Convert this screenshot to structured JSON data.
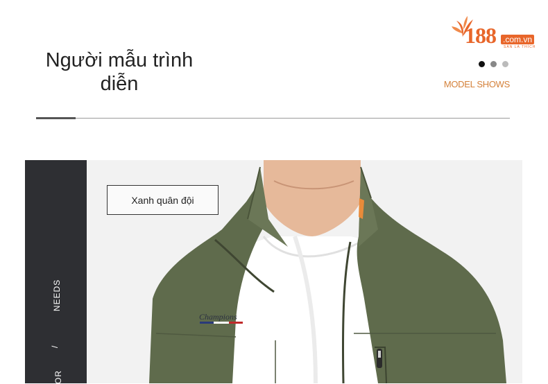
{
  "header": {
    "title": "Người mẫu trình diễn",
    "subtitle": "MODEL SHOWS"
  },
  "logo": {
    "number": "188",
    "domain": ".com.vn",
    "tagline": "SÀN LÀ THÍCH"
  },
  "carousel": {
    "dots": 3,
    "active_index": 0
  },
  "sidebar": {
    "text_needs": "NEEDS",
    "text_slash": "/",
    "text_or": "OR"
  },
  "product": {
    "color_label": "Xanh quân đội",
    "brand_embroidery": "Champions"
  },
  "colors": {
    "accent": "#d4813a",
    "logo": "#e8662a",
    "sidebar_bg": "#2e2f33",
    "vest": "#5f6b4c"
  }
}
